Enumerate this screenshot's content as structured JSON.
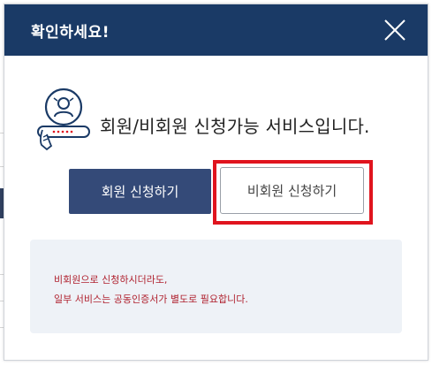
{
  "dialog": {
    "title": "확인하세요!",
    "close_icon": "close-icon",
    "message": "회원/비회원 신청가능 서비스입니다.",
    "member_icon": "member-login-icon",
    "buttons": {
      "member_label": "회원 신청하기",
      "nonmember_label": "비회원 신청하기"
    },
    "notice": {
      "line1": "비회원으로 신청하시더라도,",
      "line2": "일부 서비스는 공동인증서가 별도로 필요합니다."
    }
  },
  "colors": {
    "header_bg": "#1a3a66",
    "member_button_bg": "#344a78",
    "highlight_border": "#e0141e",
    "notice_bg": "#eef2f7",
    "notice_text": "#b0222f"
  }
}
